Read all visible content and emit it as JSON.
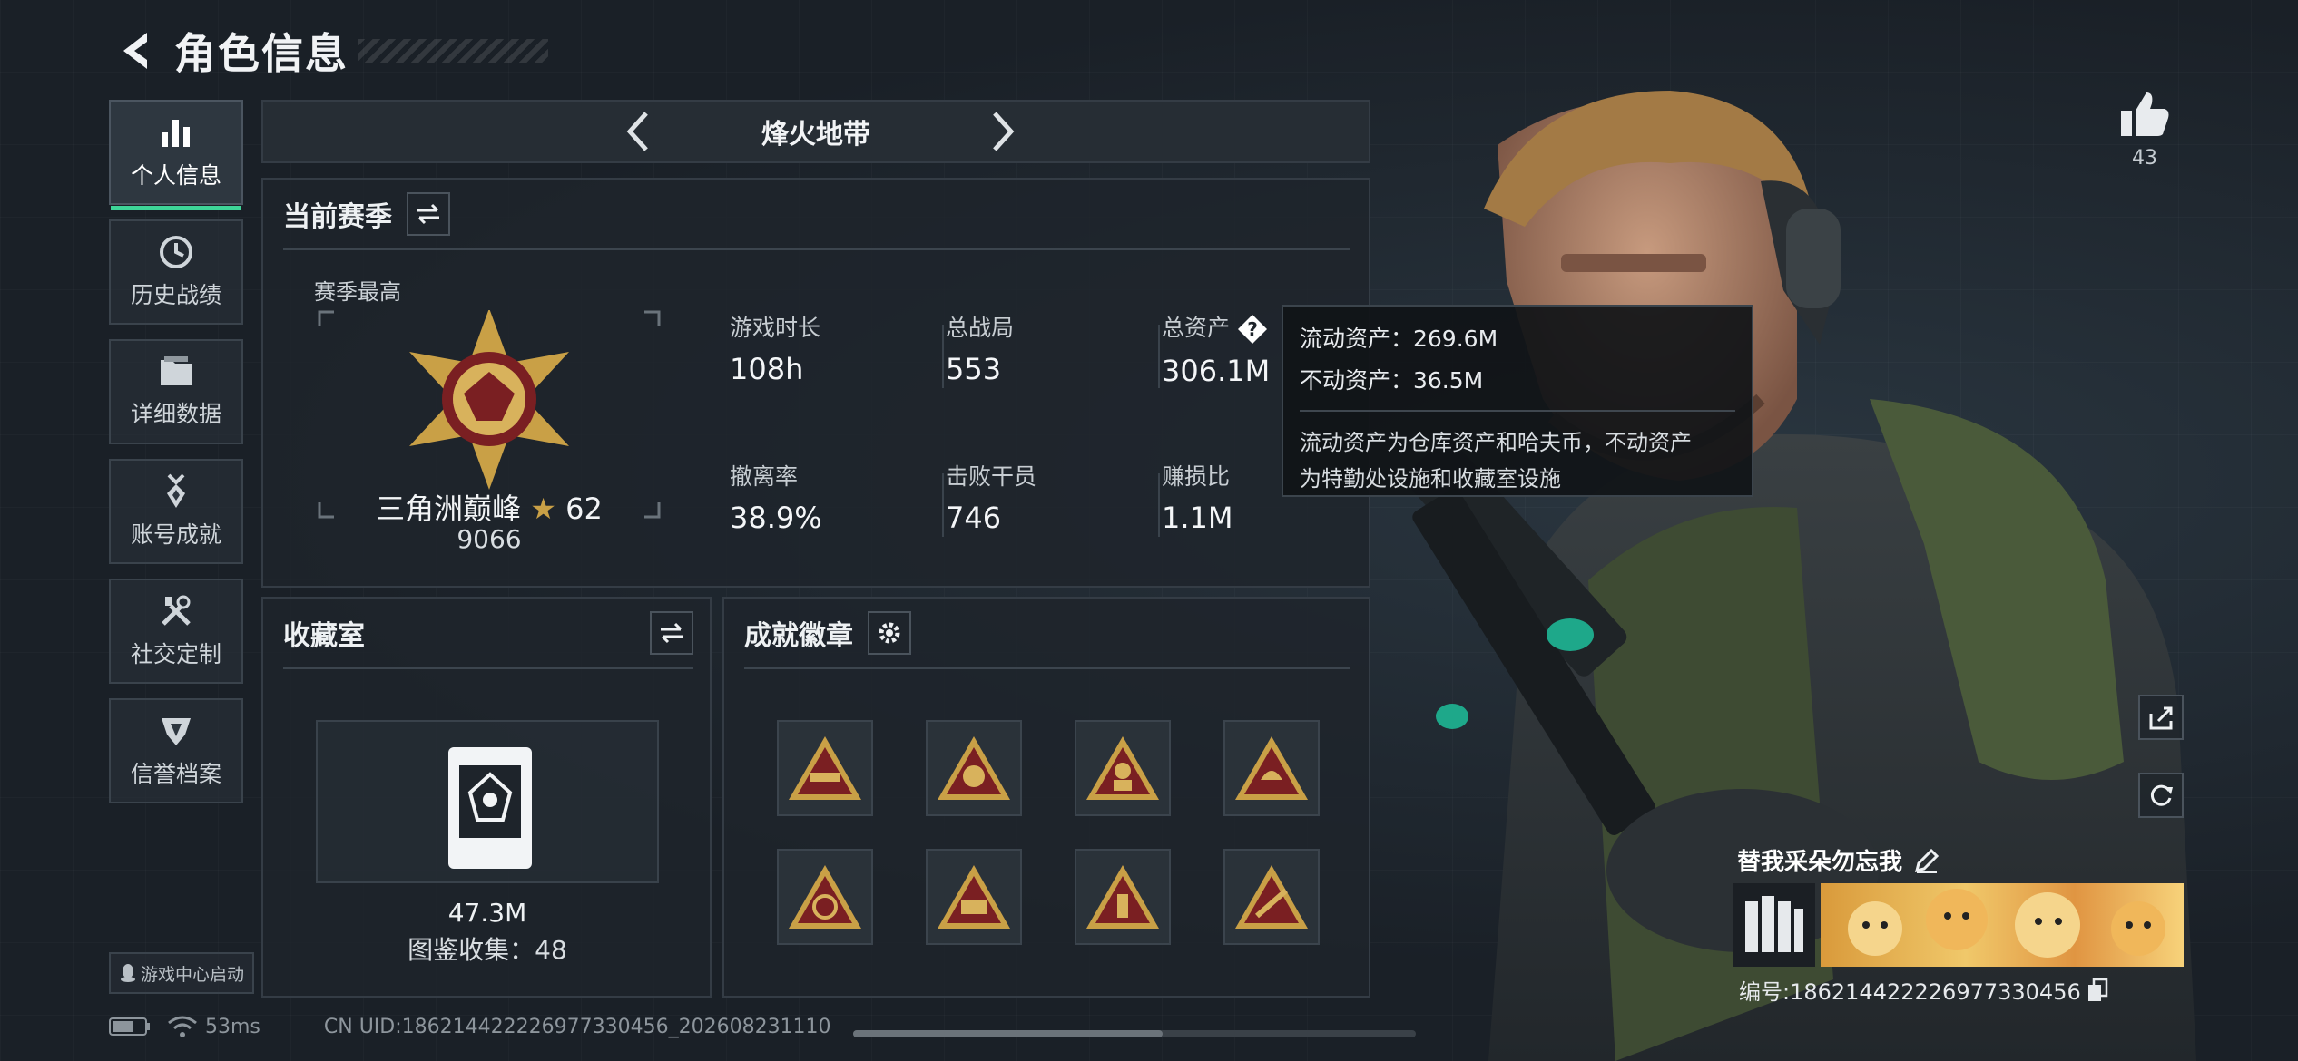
{
  "header": {
    "title": "角色信息"
  },
  "sidebar": {
    "items": [
      {
        "label": "个人信息",
        "icon": "bar-chart-icon",
        "active": true
      },
      {
        "label": "历史战绩",
        "icon": "clock-icon"
      },
      {
        "label": "详细数据",
        "icon": "folder-icon"
      },
      {
        "label": "账号成就",
        "icon": "medal-icon"
      },
      {
        "label": "社交定制",
        "icon": "tools-icon"
      },
      {
        "label": "信誉档案",
        "icon": "shield-badge-icon"
      }
    ],
    "launch_label": "游戏中心启动"
  },
  "mode": {
    "title": "烽火地带"
  },
  "season": {
    "title": "当前赛季",
    "best_label": "赛季最高",
    "rank_name": "三角洲巅峰",
    "rank_stars": "62",
    "rank_score": "9066",
    "stats": [
      {
        "label": "游戏时长",
        "value": "108h"
      },
      {
        "label": "总战局",
        "value": "553"
      },
      {
        "label": "总资产",
        "value": "306.1M"
      },
      {
        "label": "撤离率",
        "value": "38.9%"
      },
      {
        "label": "击败干员",
        "value": "746"
      },
      {
        "label": "赚损比",
        "value": "1.1M"
      }
    ]
  },
  "tooltip": {
    "liquid": "流动资产：269.6M",
    "fixed": "不动资产：36.5M",
    "desc_line1": "流动资产为仓库资产和哈夫币，不动资产",
    "desc_line2": "为特勤处设施和收藏室设施"
  },
  "collection": {
    "title": "收藏室",
    "value": "47.3M",
    "count": "图鉴收集：48"
  },
  "badges": {
    "title": "成就徽章",
    "items": [
      "badge-helicopter-icon",
      "badge-globe-icon",
      "badge-soldier-icon",
      "badge-soldier-helmet-icon",
      "badge-aircraft-icon",
      "badge-tank-icon",
      "badge-tower-icon",
      "badge-rifle-icon"
    ]
  },
  "status": {
    "ping": "53ms",
    "uid": "CN UID:186214422226977330456_202608231110",
    "progress": 0.55
  },
  "profile": {
    "likes": "43",
    "nickname": "替我采朵勿忘我",
    "id_line": "编号:186214422226977330456"
  },
  "colors": {
    "accent": "#3ed598",
    "badge_gold": "#c9a046",
    "badge_red": "#7a1f22"
  }
}
